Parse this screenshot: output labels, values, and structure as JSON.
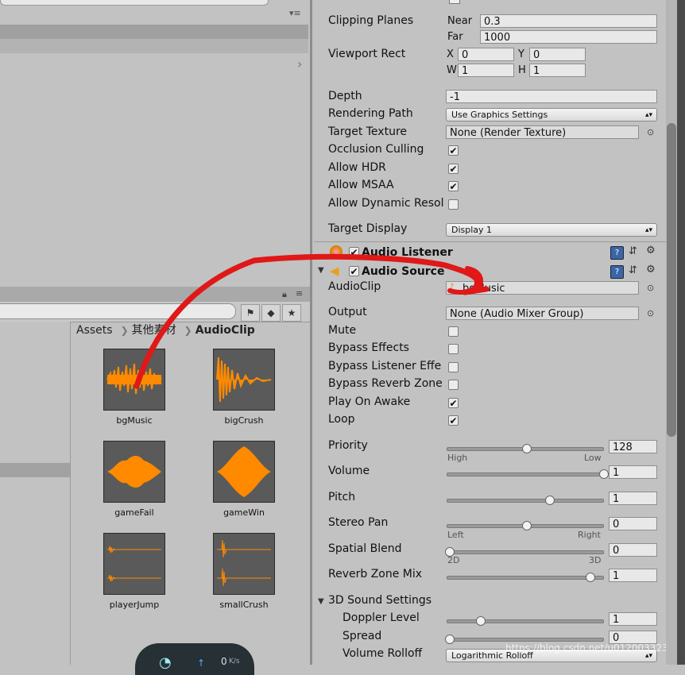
{
  "top_panel": {
    "menu_glyph": "▾≡",
    "scroll_right": "›"
  },
  "project_toolbar": {
    "tool1": "⚑",
    "tool2": "◆",
    "tool3": "★"
  },
  "breadcrumb": {
    "root": "Assets",
    "middle": "其他素材",
    "last": "AudioClip"
  },
  "assets": [
    {
      "name": "bgMusic",
      "icon": "waveform-dense-icon"
    },
    {
      "name": "bigCrush",
      "icon": "waveform-decay-icon"
    },
    {
      "name": "gameFail",
      "icon": "waveform-blob-icon"
    },
    {
      "name": "gameWin",
      "icon": "waveform-diamond-icon"
    },
    {
      "name": "playerJump",
      "icon": "waveform-flat-icon"
    },
    {
      "name": "smallCrush",
      "icon": "waveform-spike-icon"
    }
  ],
  "gauge": {
    "value": "0",
    "unit": "K/s"
  },
  "camera": {
    "clipping_planes": {
      "label": "Clipping Planes",
      "near_label": "Near",
      "near": "0.3",
      "far_label": "Far",
      "far": "1000"
    },
    "viewport": {
      "label": "Viewport Rect",
      "x_label": "X",
      "x": "0",
      "y_label": "Y",
      "y": "0",
      "w_label": "W",
      "w": "1",
      "h_label": "H",
      "h": "1"
    },
    "depth": {
      "label": "Depth",
      "value": "-1"
    },
    "rendering_path": {
      "label": "Rendering Path",
      "value": "Use Graphics Settings"
    },
    "target_texture": {
      "label": "Target Texture",
      "value": "None (Render Texture)"
    },
    "occlusion_culling": {
      "label": "Occlusion Culling",
      "checked": true
    },
    "allow_hdr": {
      "label": "Allow HDR",
      "checked": true
    },
    "allow_msaa": {
      "label": "Allow MSAA",
      "checked": true
    },
    "allow_dynamic": {
      "label": "Allow Dynamic Resolu",
      "checked": false
    },
    "target_display": {
      "label": "Target Display",
      "value": "Display 1"
    }
  },
  "audio_listener": {
    "title": "Audio Listener",
    "enabled": true
  },
  "audio_source": {
    "title": "Audio Source",
    "audio_clip": {
      "label": "AudioClip",
      "value": "bgMusic"
    },
    "output": {
      "label": "Output",
      "value": "None (Audio Mixer Group)"
    },
    "mute": {
      "label": "Mute",
      "checked": false
    },
    "bypass_effects": {
      "label": "Bypass Effects",
      "checked": false
    },
    "bypass_listener": {
      "label": "Bypass Listener Effe",
      "checked": false
    },
    "bypass_reverb": {
      "label": "Bypass Reverb Zone",
      "checked": false
    },
    "play_on_awake": {
      "label": "Play On Awake",
      "checked": true
    },
    "loop": {
      "label": "Loop",
      "checked": true
    },
    "priority": {
      "label": "Priority",
      "value": "128",
      "level": 0.5,
      "min_label": "High",
      "max_label": "Low"
    },
    "volume": {
      "label": "Volume",
      "value": "1",
      "level": 1.0
    },
    "pitch": {
      "label": "Pitch",
      "value": "1",
      "level": 0.65
    },
    "stereo_pan": {
      "label": "Stereo Pan",
      "value": "0",
      "level": 0.5,
      "min_label": "Left",
      "max_label": "Right"
    },
    "spatial_blend": {
      "label": "Spatial Blend",
      "value": "0",
      "level": 0.0,
      "min_label": "2D",
      "max_label": "3D"
    },
    "reverb_mix": {
      "label": "Reverb Zone Mix",
      "value": "1",
      "level": 0.91
    },
    "sound_3d": {
      "label": "3D Sound Settings"
    },
    "doppler": {
      "label": "Doppler Level",
      "value": "1",
      "level": 0.2
    },
    "spread": {
      "label": "Spread",
      "value": "0",
      "level": 0.0
    },
    "rolloff": {
      "label": "Volume Rolloff",
      "value": "Logarithmic Rolloff"
    }
  },
  "watermark": "https://blog.csdn.net/u012003323",
  "colors": {
    "annotation": "#e01818",
    "waveform": "#ff8a00",
    "accent": "#3a66a8"
  }
}
